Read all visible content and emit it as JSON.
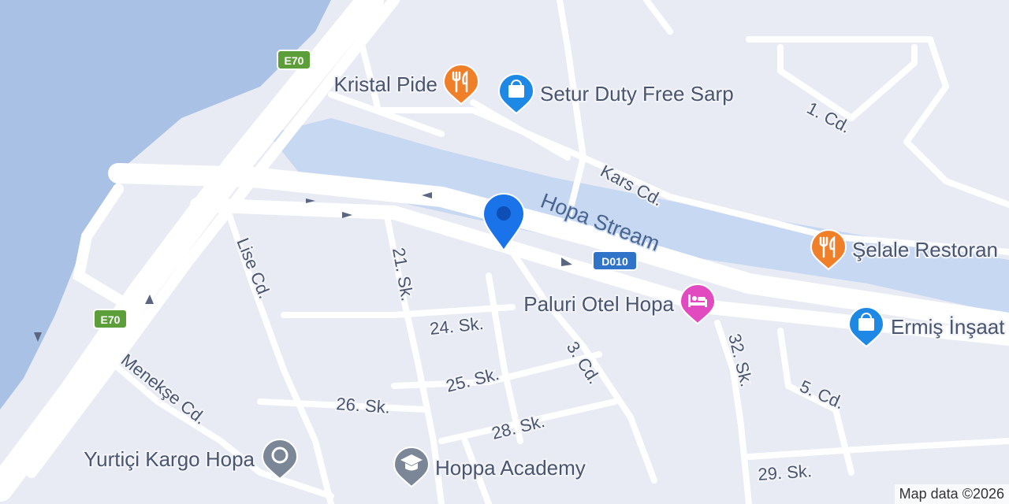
{
  "map": {
    "attribution": "Map data ©2026",
    "colors": {
      "land": "#e8ebf3",
      "water": "#c6d8f2",
      "sea": "#aac1e6",
      "road": "#ffffff",
      "food_pin": "#f07f2a",
      "shop_pin": "#1e88e5",
      "hotel_pin": "#e24bc0",
      "generic_pin": "#7b8696",
      "location_marker": "#1a73e8"
    },
    "water_label": "Hopa Stream",
    "shields": [
      "E70",
      "E70",
      "D010"
    ],
    "streets": [
      "1. Cd.",
      "Kars Cd.",
      "Lise Cd.",
      "21. Sk.",
      "24. Sk.",
      "3. Cd.",
      "32. Sk.",
      "25. Sk.",
      "5. Cd.",
      "Menekşe Cd.",
      "26. Sk.",
      "28. Sk.",
      "29. Sk."
    ],
    "pois": [
      {
        "name": "Kristal Pide",
        "icon": "fork-knife-icon",
        "category": "food"
      },
      {
        "name": "Setur Duty Free Sarp",
        "icon": "shopping-bag-icon",
        "category": "shop"
      },
      {
        "name": "Şelale Restoran",
        "icon": "fork-knife-icon",
        "category": "food"
      },
      {
        "name": "Paluri Otel Hopa",
        "icon": "bed-icon",
        "category": "hotel"
      },
      {
        "name": "Ermiş İnşaat",
        "icon": "shopping-bag-icon",
        "category": "shop"
      },
      {
        "name": "Yurtiçi Kargo Hopa",
        "icon": "circle-dot-icon",
        "category": "service"
      },
      {
        "name": "Hoppa Academy",
        "icon": "graduation-cap-icon",
        "category": "education"
      }
    ]
  }
}
